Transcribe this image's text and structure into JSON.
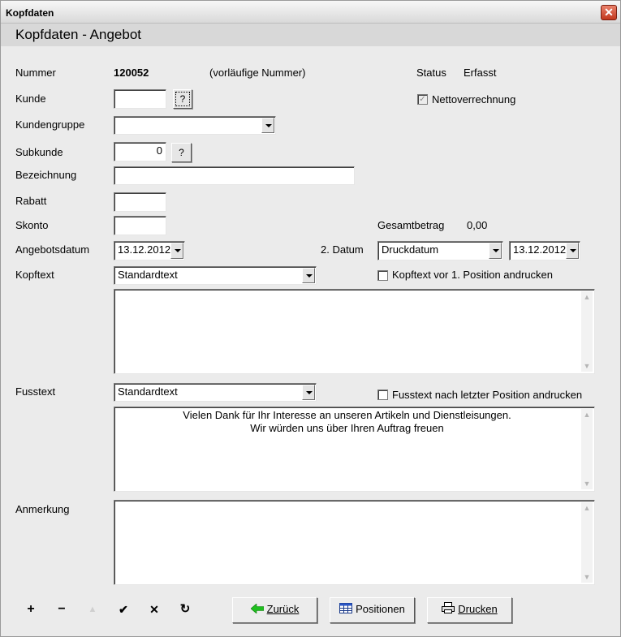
{
  "window": {
    "title": "Kopfdaten",
    "close_glyph": "✕"
  },
  "header": {
    "title": "Kopfdaten - Angebot"
  },
  "form": {
    "nummer": {
      "label": "Nummer",
      "value": "120052",
      "note": "(vorläufige Nummer)"
    },
    "status": {
      "label": "Status",
      "value": "Erfasst"
    },
    "kunde": {
      "label": "Kunde",
      "value": "",
      "help": "?"
    },
    "nettoverrechnung": {
      "label": "Nettoverrechnung",
      "checked": true,
      "check_glyph": "✓"
    },
    "kundengruppe": {
      "label": "Kundengruppe",
      "value": ""
    },
    "subkunde": {
      "label": "Subkunde",
      "value": "0",
      "help": "?"
    },
    "bezeichnung": {
      "label": "Bezeichnung",
      "value": ""
    },
    "rabatt": {
      "label": "Rabatt",
      "value": ""
    },
    "skonto": {
      "label": "Skonto",
      "value": ""
    },
    "gesamtbetrag": {
      "label": "Gesamtbetrag",
      "value": "0,00"
    },
    "angebotsdatum": {
      "label": "Angebotsdatum",
      "value": "13.12.2012"
    },
    "datum2": {
      "label": "2. Datum",
      "type_value": "Druckdatum",
      "date_value": "13.12.2012"
    },
    "kopftext": {
      "label": "Kopftext",
      "value": "Standardtext",
      "print_label": "Kopftext vor 1. Position andrucken",
      "print_checked": false,
      "body": ""
    },
    "fusstext": {
      "label": "Fusstext",
      "value": "Standardtext",
      "print_label": "Fusstext nach letzter Position andrucken",
      "print_checked": false,
      "body": "Vielen Dank für Ihr Interesse an unseren Artikeln und Dienstleisungen.\nWir würden uns über Ihren Auftrag freuen"
    },
    "anmerkung": {
      "label": "Anmerkung",
      "body": ""
    }
  },
  "toolbar": {
    "add": "+",
    "remove": "−",
    "up": "▲",
    "confirm": "✔",
    "cancel": "✕",
    "refresh": "↻"
  },
  "buttons": {
    "back": {
      "label": "Zurück",
      "icon": "left-arrow-icon"
    },
    "positions": {
      "label": "Positionen",
      "icon": "table-icon"
    },
    "print": {
      "label": "Drucken",
      "icon": "printer-icon"
    }
  },
  "colors": {
    "back_arrow": "#1fbf1f",
    "close_red": "#c2371d"
  }
}
